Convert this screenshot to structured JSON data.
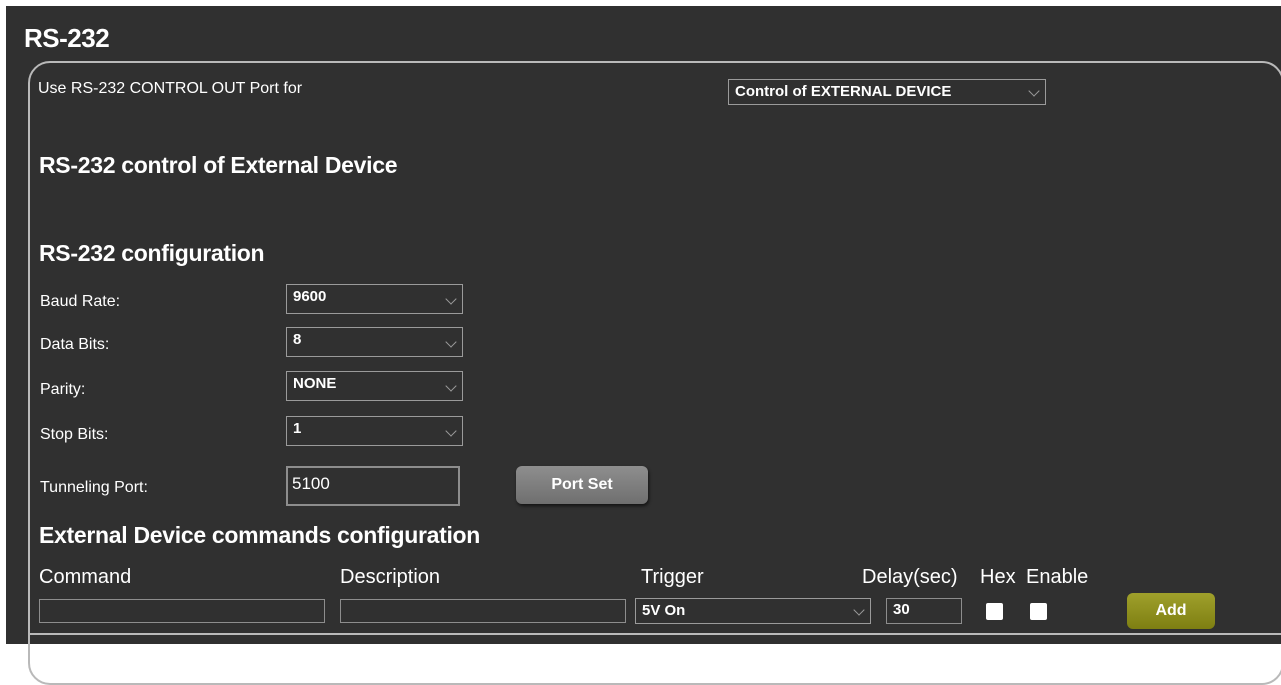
{
  "page_title": "RS-232",
  "port_use": {
    "label": "Use RS-232 CONTROL OUT Port for",
    "selected": "Control of EXTERNAL DEVICE"
  },
  "section_external": "RS-232 control of External Device",
  "section_config": "RS-232 configuration",
  "config": {
    "baud_label": "Baud Rate:",
    "baud_value": "9600",
    "data_bits_label": "Data Bits:",
    "data_bits_value": "8",
    "parity_label": "Parity:",
    "parity_value": "NONE",
    "stop_bits_label": "Stop Bits:",
    "stop_bits_value": "1",
    "tunnel_label": "Tunneling Port:",
    "tunnel_value": "5100",
    "port_set_label": "Port Set"
  },
  "section_commands": "External Device commands configuration",
  "commands": {
    "col_command": "Command",
    "col_description": "Description",
    "col_trigger": "Trigger",
    "col_delay": "Delay(sec)",
    "col_hex": "Hex",
    "col_enable": "Enable",
    "row": {
      "command": "",
      "description": "",
      "trigger": "5V On",
      "delay": "30",
      "hex": true,
      "enable": true
    },
    "add_label": "Add"
  },
  "colors": {
    "background": "#303030",
    "panel_border": "#b9b9b9",
    "add_button": "#8f9020",
    "port_set_button": "#7f7f7f"
  },
  "icons": [
    "chevron-down-icon"
  ]
}
